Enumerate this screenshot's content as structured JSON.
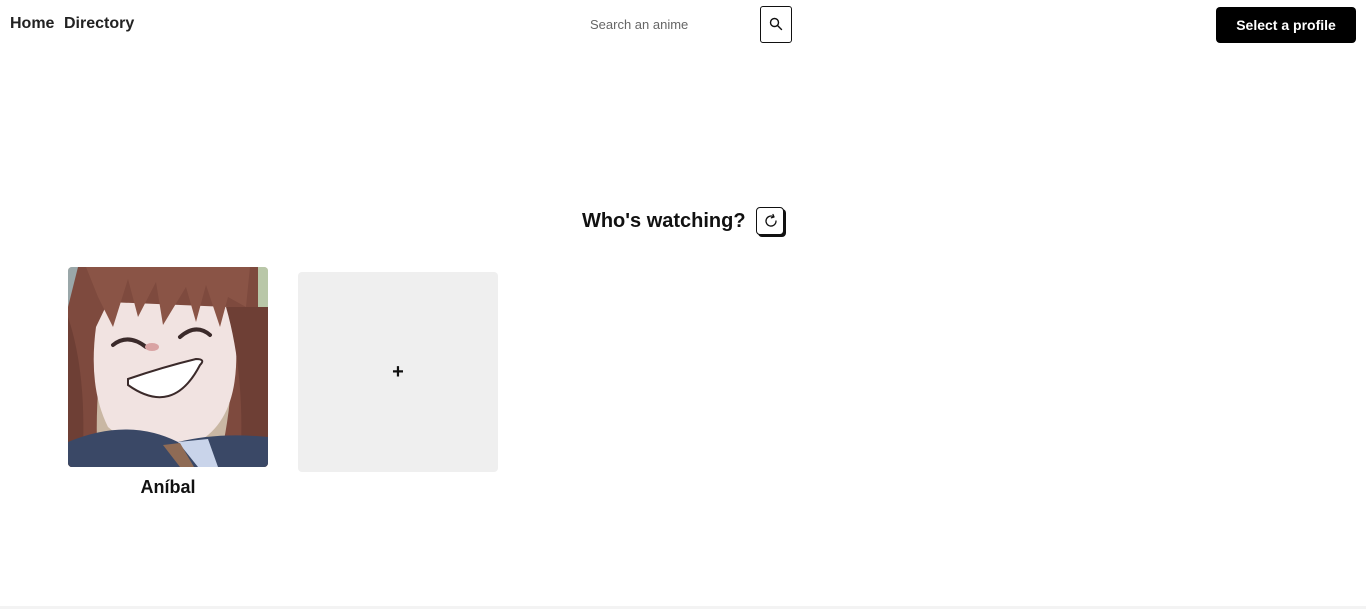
{
  "nav": {
    "home_label": "Home",
    "directory_label": "Directory"
  },
  "search": {
    "placeholder": "Search an anime",
    "value": "",
    "button_icon": "search-icon"
  },
  "header": {
    "profile_button_label": "Select a profile"
  },
  "main": {
    "heading": "Who's watching?",
    "refresh_icon": "refresh-icon",
    "profiles": [
      {
        "name": "Aníbal",
        "avatar": "anime-girl-avatar"
      }
    ],
    "add_profile_label": "+"
  },
  "colors": {
    "primary_button_bg": "#000000",
    "add_card_bg": "#efefef"
  }
}
